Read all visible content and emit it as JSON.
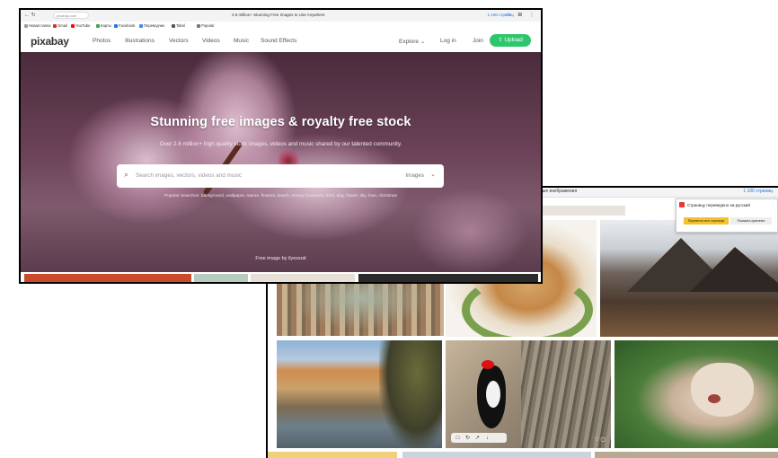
{
  "back_window": {
    "tab_title": "ные изображения",
    "toolbar_right": "1 100 страниц",
    "translate_popup": {
      "title": "Страницу переведено на русский",
      "translate_all": "Перевести все страницы",
      "show_original": "Показать оригинал"
    },
    "hover_icons": [
      "□",
      "↻",
      "↗",
      "↓"
    ],
    "hover_right": "♡  ▢"
  },
  "front_window": {
    "browser": {
      "nav": "←  ↻",
      "url": "pixabay.com",
      "tab_title": "2.6 million+ Stunning Free Images to Use Anywhere",
      "right_text": "1 100 страниц",
      "icons": "☆ ⊞ ⋮"
    },
    "bookmarks": [
      {
        "label": "Новая папка",
        "color": "#9e9e9e"
      },
      {
        "label": "Gmail",
        "color": "#d93025"
      },
      {
        "label": "YouTube",
        "color": "#ff0000"
      },
      {
        "label": "Карты",
        "color": "#34a853"
      },
      {
        "label": "Facebook",
        "color": "#1877f2"
      },
      {
        "label": "Переводчик",
        "color": "#4285f4"
      },
      {
        "label": "Tabel",
        "color": "#555555"
      },
      {
        "label": "Popular",
        "color": "#777777"
      }
    ],
    "header": {
      "logo": "pixabay",
      "nav": [
        "Photos",
        "Illustrations",
        "Vectors",
        "Videos",
        "Music",
        "Sound Effects"
      ],
      "explore": "Explore ⌄",
      "login": "Log in",
      "join": "Join",
      "upload": "⇧ Upload"
    },
    "hero": {
      "title": "Stunning free images & royalty free stock",
      "subtitle": "Over 2.6 million+ high quality stock images, videos and music shared by our talented community.",
      "search_placeholder": "Search images, vectors, videos and music",
      "search_type": "Images",
      "search_icon": "⌕",
      "chevron": "⌄",
      "popular": "Popular Searches: background, wallpaper, nature, flowers, beach, money, business, food, dog, flower, sky, love, christmas",
      "credit": "Free image by ilyessuti"
    }
  },
  "colors": {
    "accent_green": "#2ec66d",
    "translate_yellow": "#f6c22b"
  }
}
